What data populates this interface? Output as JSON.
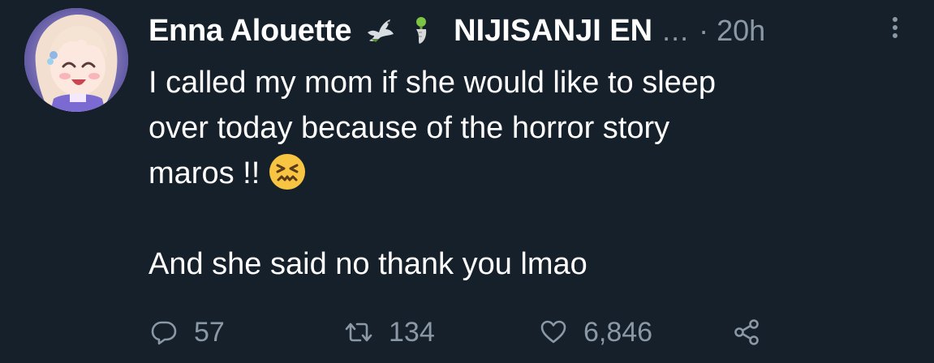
{
  "tweet": {
    "author": {
      "display_name": "Enna Alouette",
      "affiliation": "NIJISANJI EN",
      "truncation": "...",
      "badges": [
        "dove-icon",
        "bell-pepper-icon"
      ],
      "avatar": "anime-avatar"
    },
    "separator": "·",
    "time": "20h",
    "more_icon": "more-vertical-icon",
    "text": {
      "line1": "I called my mom if she would like to sleep",
      "line2": "over today because of the horror story",
      "line3": "maros !!",
      "emoji": "confounded-face-emoji",
      "line5": "And she said no thank you lmao"
    },
    "actions": {
      "reply": {
        "icon": "reply-icon",
        "count": "57"
      },
      "retweet": {
        "icon": "retweet-icon",
        "count": "134"
      },
      "like": {
        "icon": "heart-icon",
        "count": "6,846"
      },
      "share": {
        "icon": "share-icon"
      }
    }
  },
  "colors": {
    "background": "#15202b",
    "text": "#ffffff",
    "muted": "#8b98a5"
  }
}
